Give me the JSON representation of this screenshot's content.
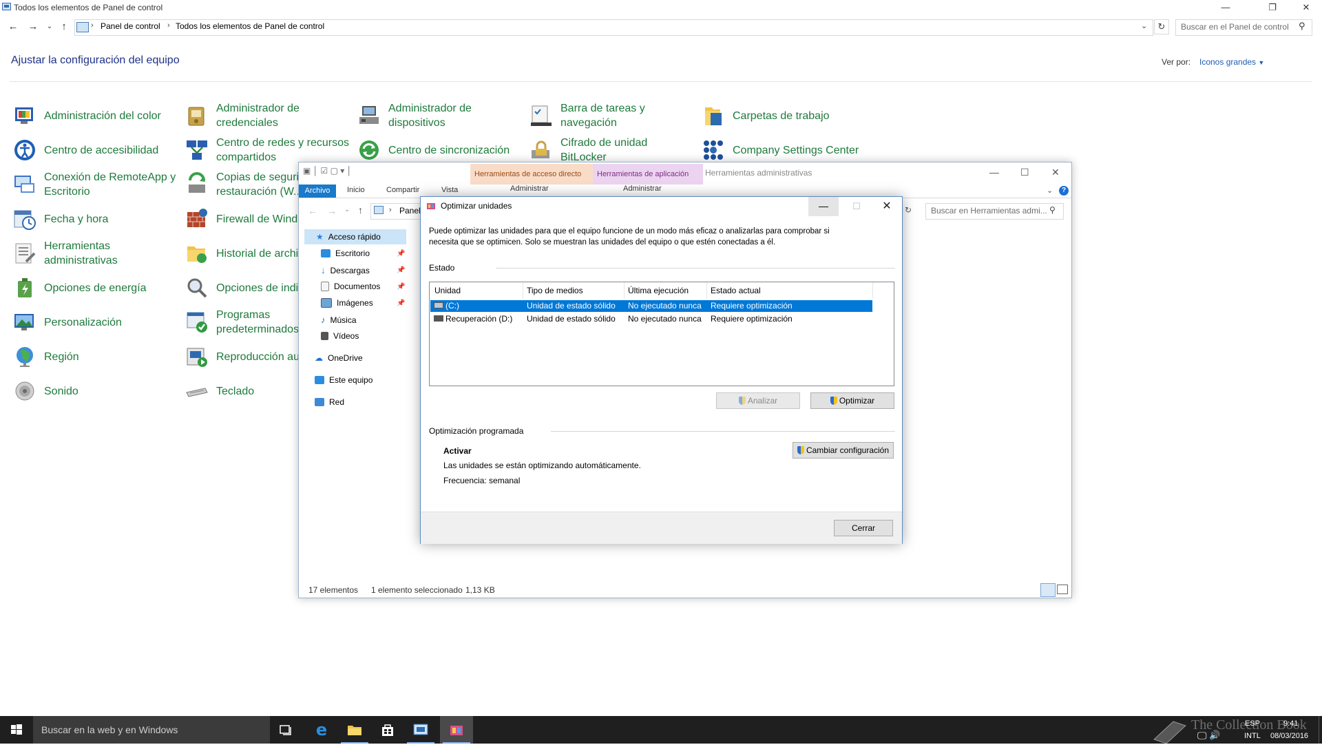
{
  "control_panel": {
    "window_title": "Todos los elementos de Panel de control",
    "breadcrumb": [
      "Panel de control",
      "Todos los elementos de Panel de control"
    ],
    "search_placeholder": "Buscar en el Panel de control",
    "heading": "Ajustar la configuración del equipo",
    "view_by_label": "Ver por:",
    "view_by_value": "Iconos grandes",
    "items": [
      {
        "label": "Administración del color",
        "icon": "color-management-icon"
      },
      {
        "label": "Centro de accesibilidad",
        "icon": "accessibility-icon"
      },
      {
        "label": "Conexión de RemoteApp y\nEscritorio",
        "icon": "remoteapp-icon"
      },
      {
        "label": "Fecha y hora",
        "icon": "clock-icon"
      },
      {
        "label": "Herramientas\nadministrativas",
        "icon": "admin-tools-icon"
      },
      {
        "label": "Opciones de energía",
        "icon": "power-icon"
      },
      {
        "label": "Personalización",
        "icon": "personalization-icon"
      },
      {
        "label": "Región",
        "icon": "globe-icon"
      },
      {
        "label": "Sonido",
        "icon": "speaker-icon"
      },
      {
        "label": "Administrador de\ncredenciales",
        "icon": "credentials-icon"
      },
      {
        "label": "Centro de redes y recursos\ncompartidos",
        "icon": "network-icon"
      },
      {
        "label": "Copias de seguri\nrestauración (W...",
        "icon": "backup-icon"
      },
      {
        "label": "Firewall de Wind",
        "icon": "firewall-icon"
      },
      {
        "label": "Historial de archiv",
        "icon": "file-history-icon"
      },
      {
        "label": "Opciones de indiz",
        "icon": "indexing-icon"
      },
      {
        "label": "Programas\npredeterminados",
        "icon": "default-programs-icon"
      },
      {
        "label": "Reproducción aut",
        "icon": "autoplay-icon"
      },
      {
        "label": "Teclado",
        "icon": "keyboard-icon"
      },
      {
        "label": "Administrador de\ndispositivos",
        "icon": "device-manager-icon"
      },
      {
        "label": "Centro de sincronización",
        "icon": "sync-icon"
      },
      {
        "label": "Barra de tareas y\nnavegación",
        "icon": "taskbar-icon"
      },
      {
        "label": "Cifrado de unidad\nBitLocker",
        "icon": "bitlocker-icon"
      },
      {
        "label": "Carpetas de trabajo",
        "icon": "work-folders-icon"
      },
      {
        "label": "Company Settings Center",
        "icon": "company-settings-icon"
      }
    ]
  },
  "explorer": {
    "title": "Herramientas administrativas",
    "ctx_tab_1": "Herramientas de acceso directo",
    "ctx_tab_2": "Herramientas de aplicación",
    "ctx_sub_1": "Administrar",
    "ctx_sub_2": "Administrar",
    "ribbon_tabs": [
      "Archivo",
      "Inicio",
      "Compartir",
      "Vista"
    ],
    "address": "Panel",
    "search_placeholder": "Buscar en Herramientas admi...",
    "nav": [
      {
        "label": "Acceso rápido",
        "pinned": false
      },
      {
        "label": "Escritorio",
        "pinned": true
      },
      {
        "label": "Descargas",
        "pinned": true
      },
      {
        "label": "Documentos",
        "pinned": true
      },
      {
        "label": "Imágenes",
        "pinned": true
      },
      {
        "label": "Música",
        "pinned": false
      },
      {
        "label": "Vídeos",
        "pinned": false
      },
      {
        "label": "OneDrive",
        "pinned": false
      },
      {
        "label": "Este equipo",
        "pinned": false
      },
      {
        "label": "Red",
        "pinned": false
      }
    ],
    "status_count": "17 elementos",
    "status_selected": "1 elemento seleccionado",
    "status_size": "1,13 KB"
  },
  "dialog": {
    "title": "Optimizar unidades",
    "description": "Puede optimizar las unidades para que el equipo funcione de un modo más eficaz o analizarlas para comprobar si necesita que se optimicen. Solo se muestran las unidades del equipo o que estén conectadas a él.",
    "status_group": "Estado",
    "columns": [
      "Unidad",
      "Tipo de medios",
      "Última ejecución",
      "Estado actual"
    ],
    "drives": [
      {
        "unit": "(C:)",
        "media": "Unidad de estado sólido",
        "last_run": "No ejecutado nunca",
        "status": "Requiere optimización",
        "selected": true
      },
      {
        "unit": "Recuperación (D:)",
        "media": "Unidad de estado sólido",
        "last_run": "No ejecutado nunca",
        "status": "Requiere optimización",
        "selected": false
      }
    ],
    "analyze_button": "Analizar",
    "optimize_button": "Optimizar",
    "scheduled_group": "Optimización programada",
    "scheduled_state": "Activar",
    "scheduled_desc": "Las unidades se están optimizando automáticamente.",
    "frequency": "Frecuencia: semanal",
    "change_settings_button": "Cambiar configuración",
    "close_button": "Cerrar"
  },
  "taskbar": {
    "search_placeholder": "Buscar en la web y en Windows",
    "lang": "ESP",
    "lang2": "INTL",
    "time": "9:41",
    "date": "08/03/2016",
    "watermark": "The Collection Book"
  },
  "colors": {
    "cp_link_green": "#1e7a3c",
    "heading_blue": "#1e3287",
    "selection_blue": "#0078d7",
    "taskbar": "#1f1f1f"
  }
}
